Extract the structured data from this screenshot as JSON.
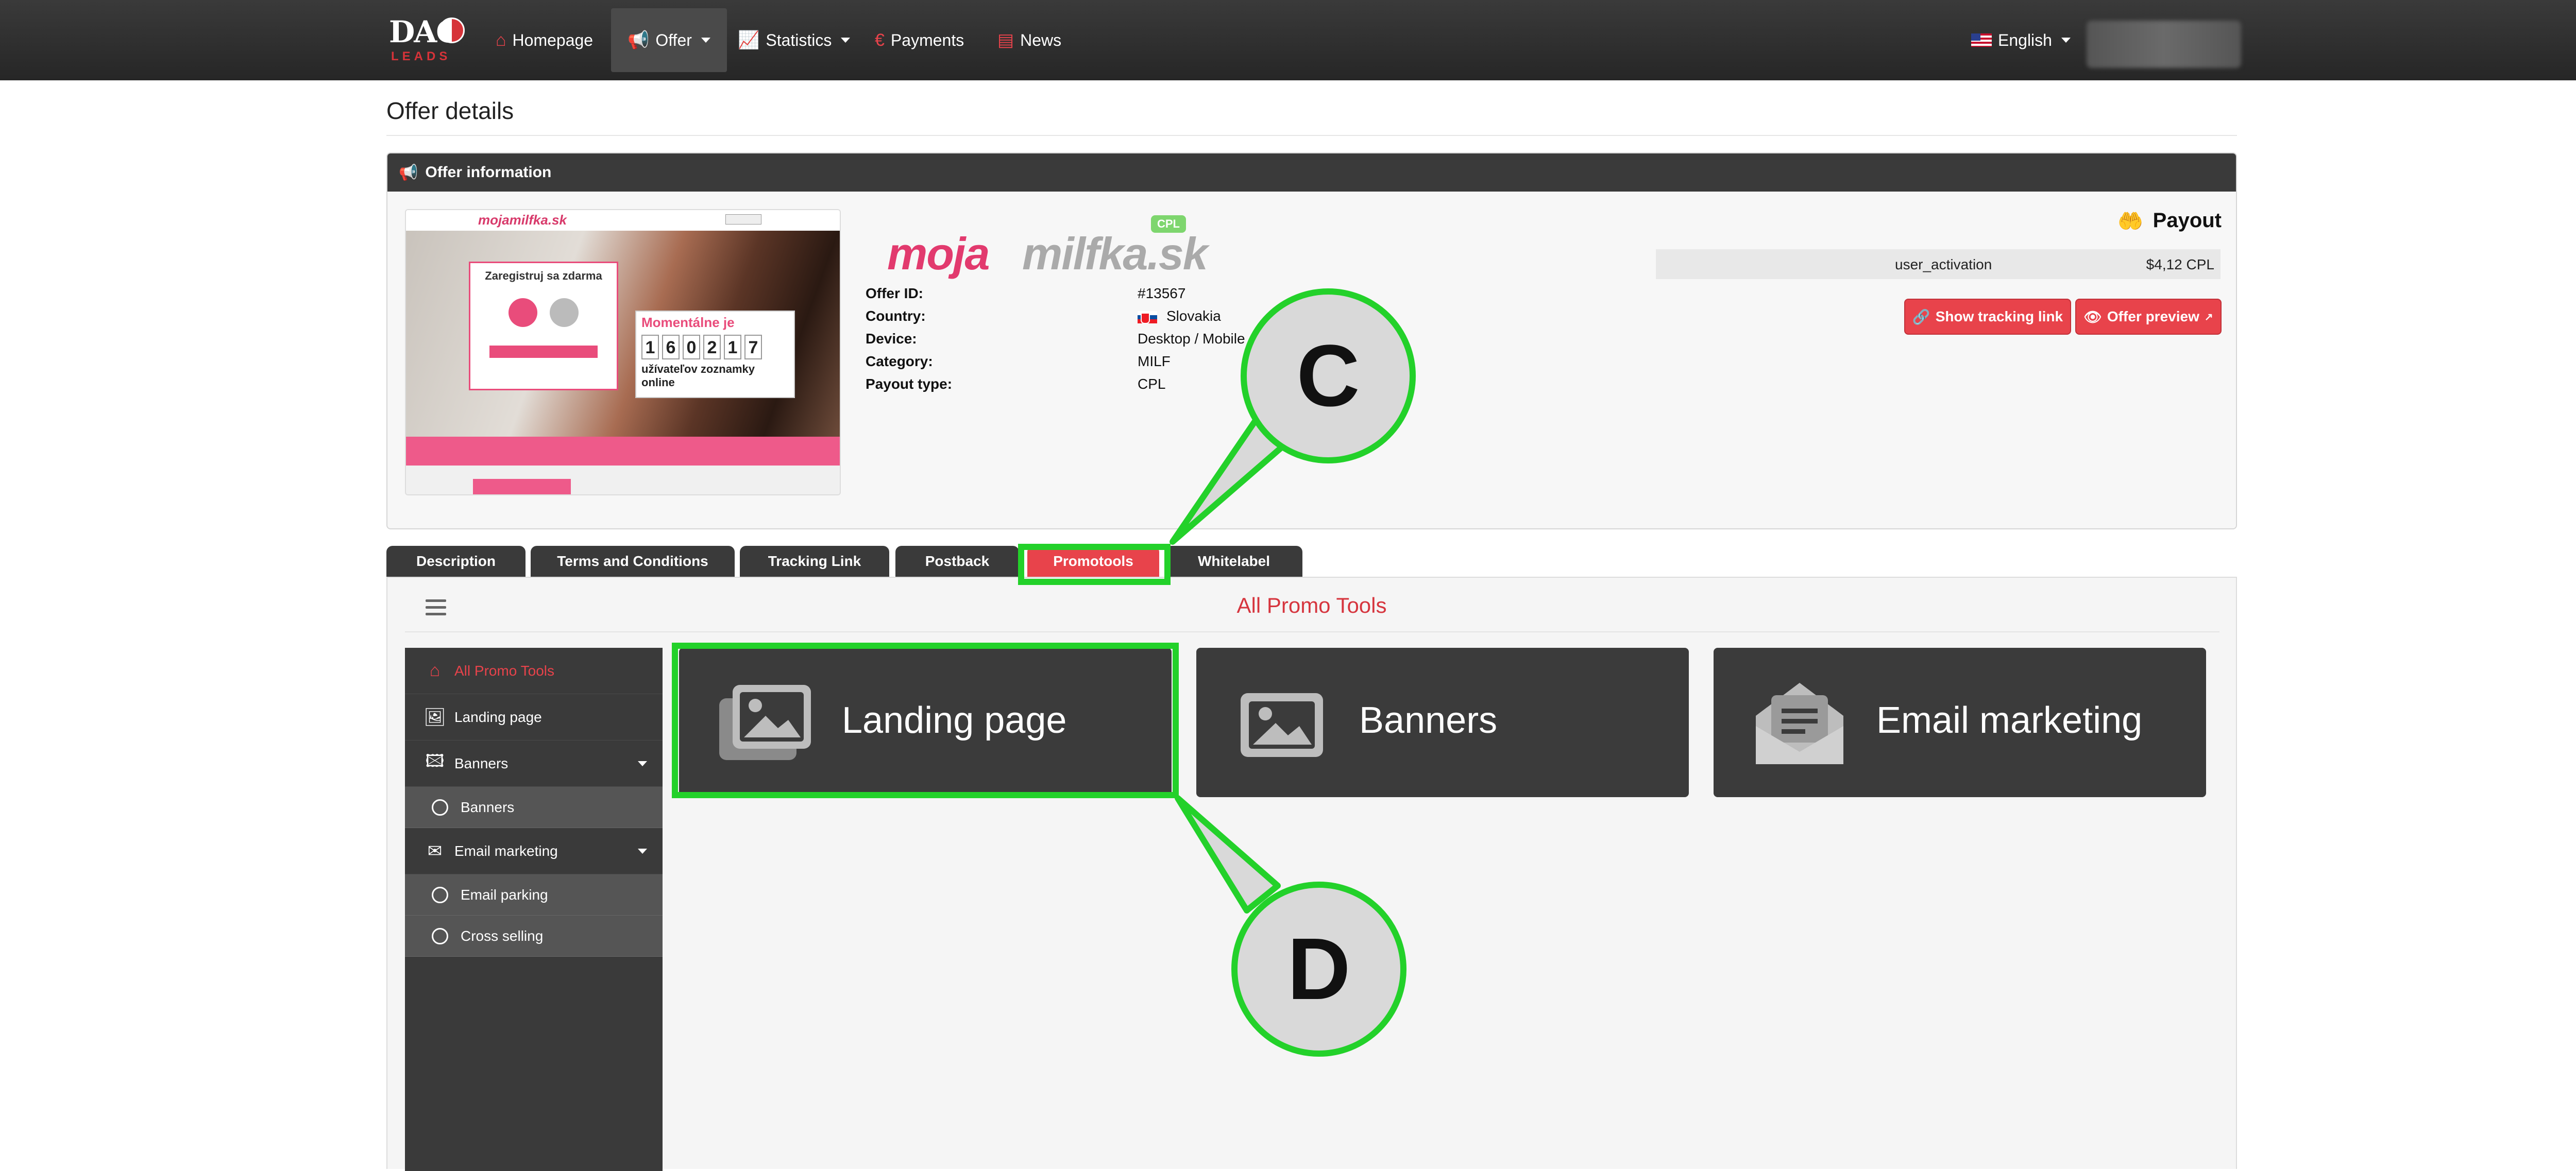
{
  "nav": {
    "logo_main": "DAO",
    "logo_sub": "LEADS",
    "items": [
      {
        "label": "Homepage",
        "icon": "home-icon"
      },
      {
        "label": "Offer",
        "icon": "megaphone-icon"
      },
      {
        "label": "Statistics",
        "icon": "chart-icon"
      },
      {
        "label": "Payments",
        "icon": "euro-icon"
      },
      {
        "label": "News",
        "icon": "newspaper-icon"
      }
    ],
    "language": "English"
  },
  "page_title": "Offer details",
  "offer": {
    "panel_title": "Offer information",
    "brand_part1": "moja",
    "brand_part2": "milfka.sk",
    "brand_badge": "CPL",
    "preview": {
      "brand": "mojamilfka.sk",
      "register_title": "Zaregistruj sa zdarma",
      "counter_title": "Momentálne je",
      "counter_digits": [
        "1",
        "6",
        "0",
        "2",
        "1",
        "7"
      ],
      "counter_caption": "užívateľov zoznamky online"
    },
    "fields": [
      {
        "label": "Offer ID:",
        "value": "#13567"
      },
      {
        "label": "Country:",
        "value": "Slovakia"
      },
      {
        "label": "Device:",
        "value": "Desktop / Mobile"
      },
      {
        "label": "Category:",
        "value": "MILF"
      },
      {
        "label": "Payout type:",
        "value": "CPL"
      }
    ],
    "payout_title": "Payout",
    "payout_name": "user_activation",
    "payout_value": "$4,12 CPL",
    "btn_tracking": "Show tracking link",
    "btn_preview": "Offer preview"
  },
  "tabs": [
    "Description",
    "Terms and Conditions",
    "Tracking Link",
    "Postback",
    "Promotools",
    "Whitelabel"
  ],
  "promo": {
    "title": "All Promo Tools",
    "sidebar": {
      "all": "All Promo Tools",
      "landing": "Landing page",
      "banners": "Banners",
      "banners_sub": "Banners",
      "email": "Email marketing",
      "email_sub1": "Email parking",
      "email_sub2": "Cross selling"
    },
    "cards": [
      "Landing page",
      "Banners",
      "Email marketing"
    ]
  },
  "annotations": {
    "c": "C",
    "d": "D"
  },
  "colors": {
    "accent": "#e8434b",
    "highlight": "#23d12a",
    "navbar": "#2f2f2f"
  }
}
